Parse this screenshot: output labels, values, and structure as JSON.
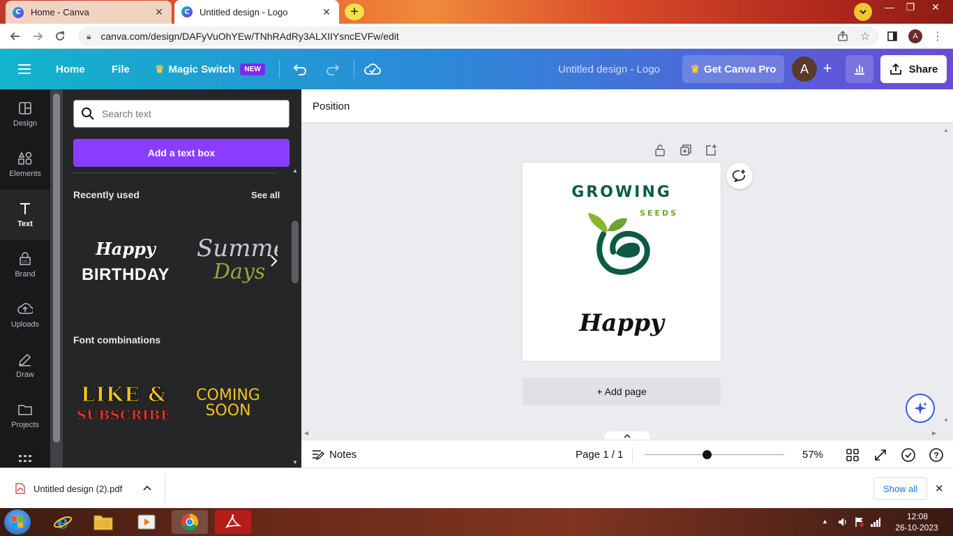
{
  "browser": {
    "tabs": [
      {
        "label": "Home - Canva",
        "active": false
      },
      {
        "label": "Untitled design - Logo",
        "active": true
      }
    ],
    "url": "canva.com/design/DAFyVuOhYEw/TNhRAdRy3ALXIIYsncEVFw/edit",
    "profile_initial": "A"
  },
  "header": {
    "home": "Home",
    "file": "File",
    "magic_switch": "Magic Switch",
    "new_badge": "NEW",
    "doc_title": "Untitled design - Logo",
    "pro": "Get Canva Pro",
    "avatar": "A",
    "share": "Share"
  },
  "rail": [
    {
      "label": "Design",
      "icon": "design-icon"
    },
    {
      "label": "Elements",
      "icon": "elements-icon"
    },
    {
      "label": "Text",
      "icon": "text-icon"
    },
    {
      "label": "Brand",
      "icon": "brand-icon"
    },
    {
      "label": "Uploads",
      "icon": "uploads-icon"
    },
    {
      "label": "Draw",
      "icon": "draw-icon"
    },
    {
      "label": "Projects",
      "icon": "projects-icon"
    }
  ],
  "panel": {
    "search_placeholder": "Search text",
    "add_text_box": "Add a text box",
    "recently_used": "Recently used",
    "see_all": "See all",
    "recent": {
      "birthday_top": "Happy",
      "birthday_bottom": "BIRTHDAY",
      "summer_top": "Summer",
      "summer_bottom": "Days"
    },
    "font_combinations": "Font combinations",
    "combos": {
      "like_top": "LIKE &",
      "like_bottom": "SUBSCRIBE",
      "coming_top": "COMING",
      "coming_bottom": "SOON"
    }
  },
  "toolbar": {
    "position": "Position"
  },
  "design": {
    "title": "GROWING",
    "subtitle": "SEEDS",
    "script": "Happy"
  },
  "add_page": "+ Add page",
  "footer": {
    "notes": "Notes",
    "page": "Page 1 / 1",
    "zoom_percent": 57,
    "zoom_label": "57%"
  },
  "download": {
    "file": "Untitled design (2).pdf",
    "show_all": "Show all"
  },
  "taskbar": {
    "time": "12:08",
    "date": "26-10-2023"
  },
  "colors": {
    "brand_purple": "#8b3dff",
    "logo_green_dark": "#0c5a45",
    "logo_green_light": "#6aa431"
  }
}
